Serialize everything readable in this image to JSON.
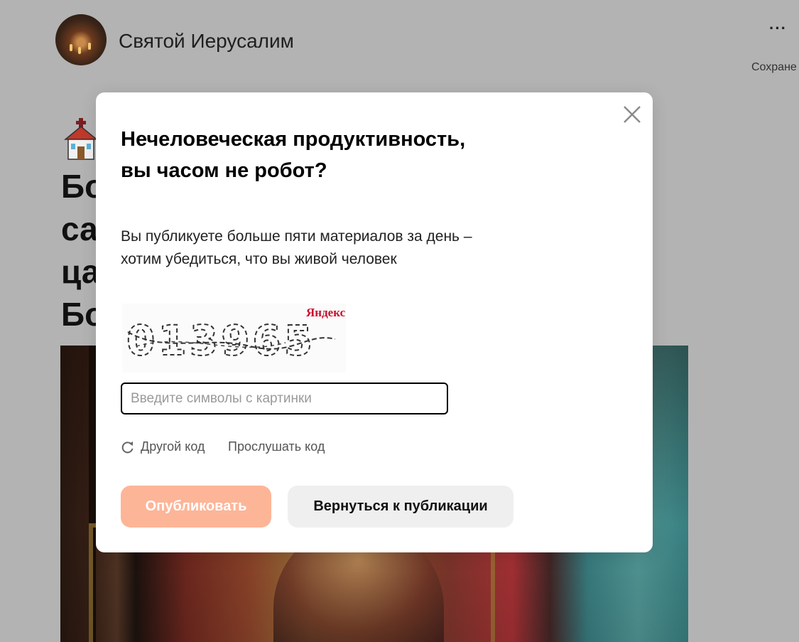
{
  "channel": {
    "name": "Святой Иерусалим",
    "avatar_icon": "channel-avatar"
  },
  "header": {
    "more_label": "···",
    "save_label": "Сохране"
  },
  "article": {
    "emoji_icon": "church-icon",
    "title": "Бо\nса\nца\nБо"
  },
  "modal": {
    "title": "Нечеловеческая продуктивность, вы часом не робот?",
    "description": "Вы публикуете больше пяти материалов за день – хотим убедиться, что вы живой человек",
    "captcha": {
      "image_text": "013965",
      "brand": "Яндекс"
    },
    "input": {
      "placeholder": "Введите символы с картинки",
      "value": ""
    },
    "refresh_label": "Другой код",
    "listen_label": "Прослушать код",
    "publish_label": "Опубликовать",
    "return_label": "Вернуться к публикации"
  },
  "colors": {
    "publish_button": "#fdb598",
    "return_button": "#efefef",
    "captcha_brand": "#c8102e",
    "backdrop": "#b3b3b3"
  }
}
